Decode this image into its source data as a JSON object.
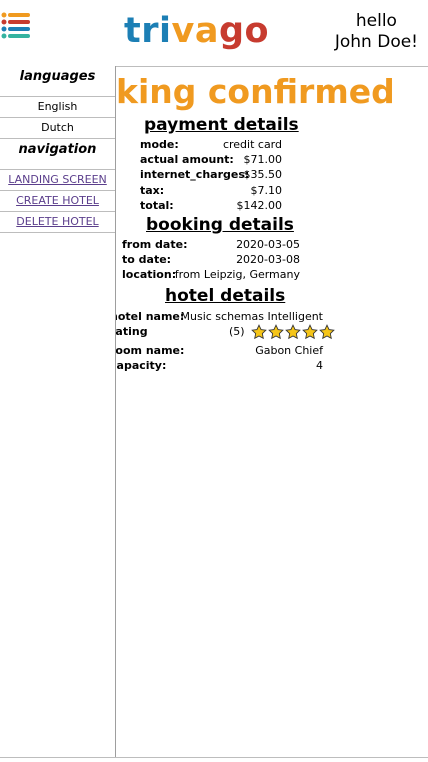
{
  "header": {
    "logo_parts": [
      "tri",
      "va",
      "go"
    ],
    "greeting_line1": "hello",
    "greeting_line2": "John Doe!",
    "menu_icon": "list-icon",
    "colors": {
      "blue": "#1c7fb5",
      "orange": "#f09a20",
      "red": "#c73b2f"
    }
  },
  "sidebar": {
    "languages_heading": "languages",
    "languages": [
      "English",
      "Dutch"
    ],
    "navigation_heading": "navigation",
    "nav_links": [
      "LANDING SCREEN",
      "CREATE HOTEL",
      "DELETE HOTEL"
    ]
  },
  "main": {
    "title": "king confirmed",
    "payment": {
      "heading": "payment details",
      "rows": [
        {
          "label": "mode:",
          "value": "credit card"
        },
        {
          "label": "actual amount:",
          "value": "$71.00"
        },
        {
          "label": "internet_charges:",
          "value": "$35.50"
        },
        {
          "label": "tax:",
          "value": "$7.10"
        },
        {
          "label": "total:",
          "value": "$142.00"
        }
      ]
    },
    "booking": {
      "heading": "booking details",
      "rows": [
        {
          "label": "from date:",
          "value": "2020-03-05"
        },
        {
          "label": "to date:",
          "value": "2020-03-08"
        },
        {
          "label": "location:",
          "value": "from Leipzig, Germany"
        }
      ]
    },
    "hotel": {
      "heading": "hotel details",
      "hotel_name_label": "hotel name:",
      "hotel_name_value": "Music schemas Intelligent",
      "rating_label": "rating",
      "rating_count": "(5)",
      "rating_stars": 5,
      "room_name_label": "room name:",
      "room_name_value": "Gabon Chief",
      "capacity_label": "capacity:",
      "capacity_value": "4",
      "star_color": "#f5c518"
    }
  }
}
